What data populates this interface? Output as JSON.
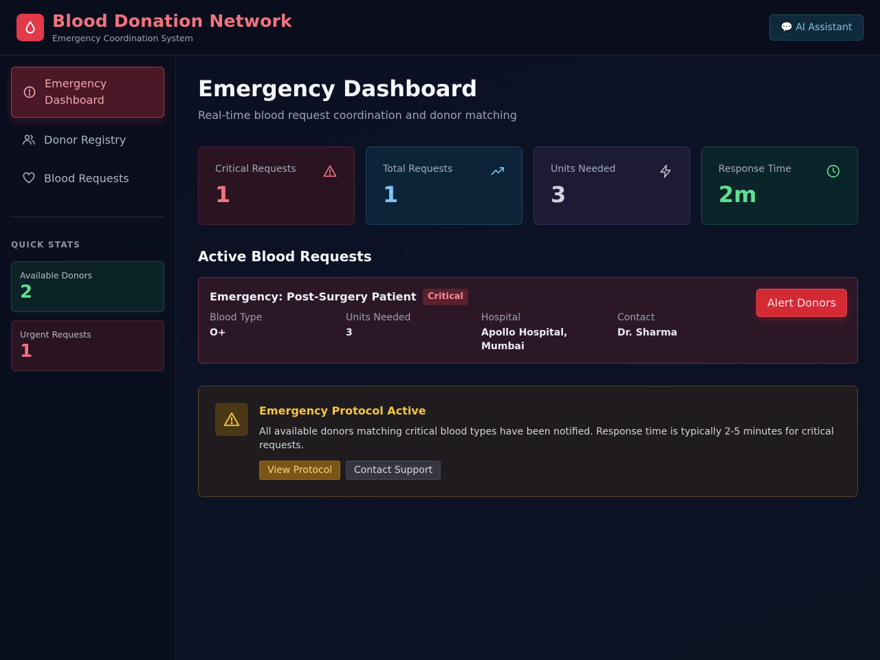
{
  "header": {
    "title": "Blood Donation Network",
    "subtitle": "Emergency Coordination System",
    "ai_button": "💬 AI Assistant",
    "logo_icon": "blood-drop-icon"
  },
  "sidebar": {
    "items": [
      {
        "label": "Emergency Dashboard",
        "icon": "alert-circle-icon",
        "active": true
      },
      {
        "label": "Donor Registry",
        "icon": "users-icon",
        "active": false
      },
      {
        "label": "Blood Requests",
        "icon": "heart-icon",
        "active": false
      }
    ],
    "quick_stats_title": "QUICK STATS",
    "quick_stats": [
      {
        "label": "Available Donors",
        "value": "2"
      },
      {
        "label": "Urgent Requests",
        "value": "1"
      }
    ]
  },
  "main": {
    "title": "Emergency Dashboard",
    "subtitle": "Real-time blood request coordination and donor matching",
    "stats": [
      {
        "label": "Critical Requests",
        "value": "1",
        "icon": "warning-triangle-icon"
      },
      {
        "label": "Total Requests",
        "value": "1",
        "icon": "trending-up-icon"
      },
      {
        "label": "Units Needed",
        "value": "3",
        "icon": "lightning-icon"
      },
      {
        "label": "Response Time",
        "value": "2m",
        "icon": "clock-icon"
      }
    ],
    "section_title": "Active Blood Requests",
    "request": {
      "title": "Emergency: Post-Surgery Patient",
      "badge": "Critical",
      "fields": [
        {
          "label": "Blood Type",
          "value": "O+"
        },
        {
          "label": "Units Needed",
          "value": "3"
        },
        {
          "label": "Hospital",
          "value": "Apollo Hospital, Mumbai"
        },
        {
          "label": "Contact",
          "value": "Dr. Sharma"
        }
      ],
      "action": "Alert Donors"
    },
    "protocol": {
      "title": "Emergency Protocol Active",
      "text": "All available donors matching critical blood types have been notified. Response time is typically 2-5 minutes for critical requests.",
      "primary_button": "View Protocol",
      "secondary_button": "Contact Support"
    }
  },
  "colors": {
    "brand": "#f2737e",
    "critical": "#d42a34",
    "success": "#5ee08f",
    "info": "#7fc4f0",
    "warning": "#f5c542"
  }
}
